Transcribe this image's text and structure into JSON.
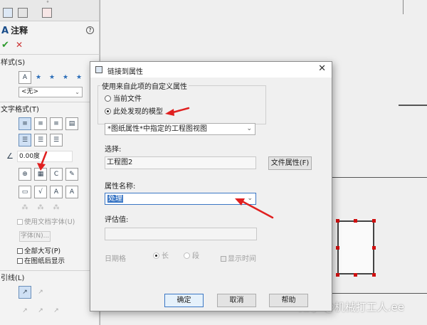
{
  "panel": {
    "title": "注释",
    "title_icon": "annotation-a-icon",
    "help_glyph": "?",
    "ok_glyph": "✔",
    "cancel_glyph": "✕",
    "style_section": "样式(S)",
    "style_select_value": "<无>",
    "text_format_section": "文字格式(T)",
    "angle_value": "0.00度",
    "use_doc_font": "使用文档字体(U)",
    "font_button": "字体(N)...",
    "all_caps": "全部大写(P)",
    "show_in_sheet": "在图纸后显示",
    "leader_section": "引线(L)"
  },
  "dialog": {
    "title": "链接到属性",
    "group_label": "使用来自此项的自定义属性",
    "radio_current_file": "当前文件",
    "radio_model_found_here": "此处发现的模型",
    "view_select": "*图纸属性*中指定的工程图视图",
    "select_label": "选择:",
    "select_value": "工程图2",
    "file_properties_button": "文件属性(F)",
    "property_name_label": "属性名称:",
    "property_name_value": "处理",
    "evaluated_value_label": "评估值:",
    "date_format_label": "日期格",
    "radio_long": "长",
    "radio_short": "段",
    "show_time_label": "显示时间",
    "ok_button": "确定",
    "cancel_button": "取消",
    "help_button": "帮助"
  },
  "watermark": "知乎 @机械打工人.ee",
  "colors": {
    "accent_blue": "#3b77c5",
    "annotation_red": "#e02020",
    "ok_green": "#2d9a2d"
  }
}
